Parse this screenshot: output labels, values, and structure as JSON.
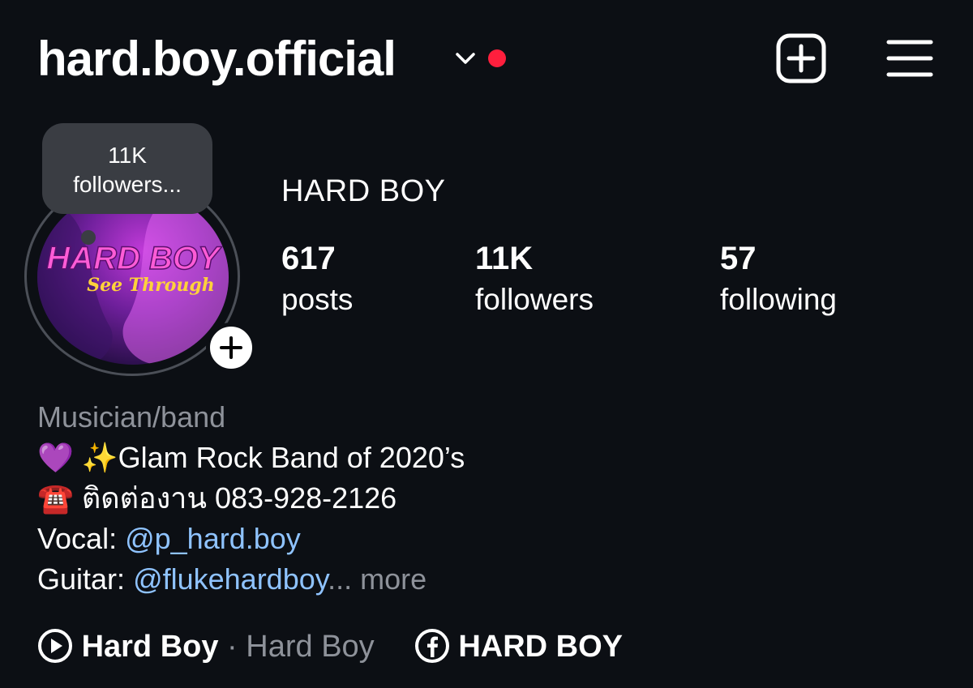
{
  "header": {
    "username": "hard.boy.official"
  },
  "profile": {
    "display_name": "HARD BOY",
    "avatar_text": {
      "title": "HARD BOY",
      "subtitle": "See Through"
    },
    "bubble": {
      "line1": "11K",
      "line2": "followers..."
    }
  },
  "stats": [
    {
      "value": "617",
      "label": "posts"
    },
    {
      "value": "11K",
      "label": "followers"
    },
    {
      "value": "57",
      "label": "following"
    }
  ],
  "bio": {
    "category": "Musician/band",
    "line1": {
      "emoji": "💜 ✨",
      "text": "Glam Rock Band of 2020’s"
    },
    "line2": {
      "emoji": "☎️",
      "text": "ติดต่องาน 083-928-2126"
    },
    "line3": {
      "prefix": "Vocal:",
      "handle": "@p_hard.boy"
    },
    "line4": {
      "prefix": "Guitar:",
      "handle": "@flukehardboy",
      "ellipsis": "...",
      "more": "more"
    }
  },
  "links": {
    "music": {
      "icon": "play-circle-icon",
      "title": "Hard Boy",
      "separator": "·",
      "artist": "Hard Boy"
    },
    "facebook": {
      "icon": "facebook-icon",
      "label": "HARD BOY"
    }
  },
  "colors": {
    "background": "#0c0f14",
    "link": "#8fc3ff",
    "notification_dot": "#ff1f3d",
    "muted": "#8e929a"
  }
}
